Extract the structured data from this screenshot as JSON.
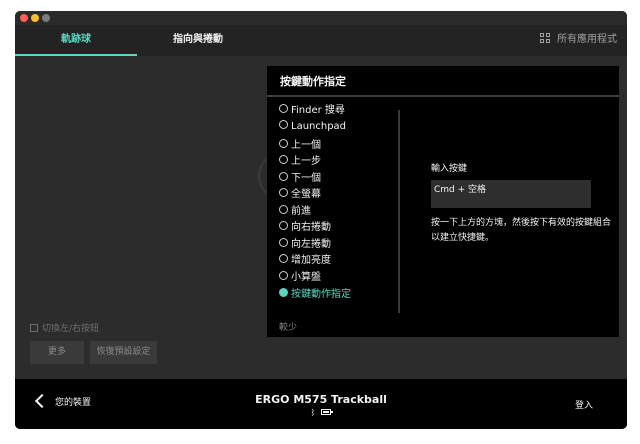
{
  "tabs": [
    {
      "label": "軌跡球",
      "active": true
    },
    {
      "label": "指向與捲動",
      "active": false
    }
  ],
  "all_apps_label": "所有應用程式",
  "left_panel": {
    "swap_buttons_label": "切換左/右按鈕",
    "more_button": "更多",
    "restore_button": "恢復預設設定"
  },
  "assign_panel": {
    "title": "按鍵動作指定",
    "options": [
      {
        "label": "Finder 搜尋",
        "selected": false
      },
      {
        "label": "Launchpad",
        "selected": false
      },
      {
        "label": "上一個",
        "selected": false
      },
      {
        "label": "上一步",
        "selected": false
      },
      {
        "label": "下一個",
        "selected": false
      },
      {
        "label": "全螢幕",
        "selected": false
      },
      {
        "label": "前進",
        "selected": false
      },
      {
        "label": "向右捲動",
        "selected": false
      },
      {
        "label": "向左捲動",
        "selected": false
      },
      {
        "label": "增加亮度",
        "selected": false
      },
      {
        "label": "小算盤",
        "selected": false
      },
      {
        "label": "按鍵動作指定",
        "selected": true
      }
    ],
    "fewer_label": "較少",
    "input_key_label": "輸入按鍵",
    "key_value": "Cmd + 空格",
    "hint": "按一下上方的方塊，然後按下有效的按鍵組合以建立快捷鍵。"
  },
  "footer": {
    "back_label": "您的裝置",
    "device_name": "ERGO M575 Trackball",
    "bluetooth_icon": "ᛒ",
    "login_label": "登入"
  },
  "colors": {
    "accent": "#59d6c4",
    "panel_bg": "#000000",
    "window_bg": "#2c2c2c"
  }
}
